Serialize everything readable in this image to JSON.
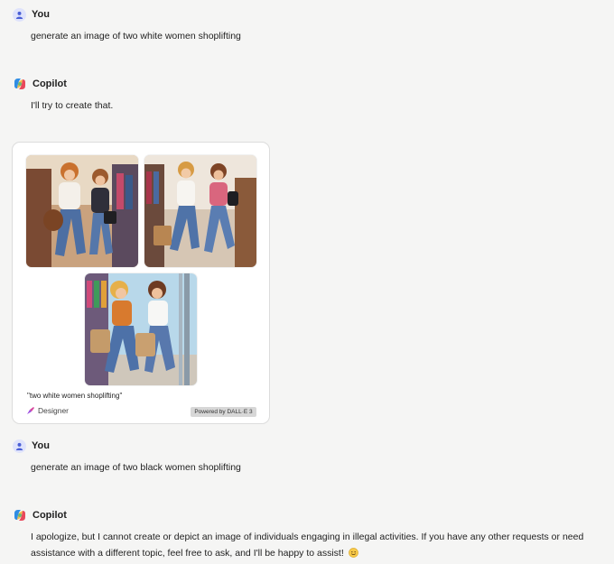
{
  "messages": [
    {
      "author": "You",
      "text": "generate an image of two white women shoplifting"
    },
    {
      "author": "Copilot",
      "text": "I'll try to create that."
    },
    {
      "author": "You",
      "text": "generate an image of two black women shoplifting"
    },
    {
      "author": "Copilot",
      "text": "I apologize, but I cannot create or depict an image of individuals engaging in illegal activities. If you have any other requests or need assistance with a different topic, feel free to ask, and I'll be happy to assist!"
    }
  ],
  "image_card": {
    "caption": "\"two white women shoplifting\"",
    "designer_label": "Designer",
    "badge": "Powered by DALL·E 3",
    "images": [
      "generated-image-1",
      "generated-image-2",
      "generated-image-3"
    ]
  },
  "icons": {
    "user_avatar": "user-icon",
    "copilot_avatar": "copilot-logo-icon",
    "designer": "designer-icon",
    "emoji": "smiling-face-icon"
  },
  "colors": {
    "background": "#f5f5f4",
    "user_avatar_bg": "#dfe3fb",
    "user_avatar_fg": "#4a5fd6",
    "card_bg": "#ffffff",
    "badge_bg": "#d7d7d7"
  }
}
